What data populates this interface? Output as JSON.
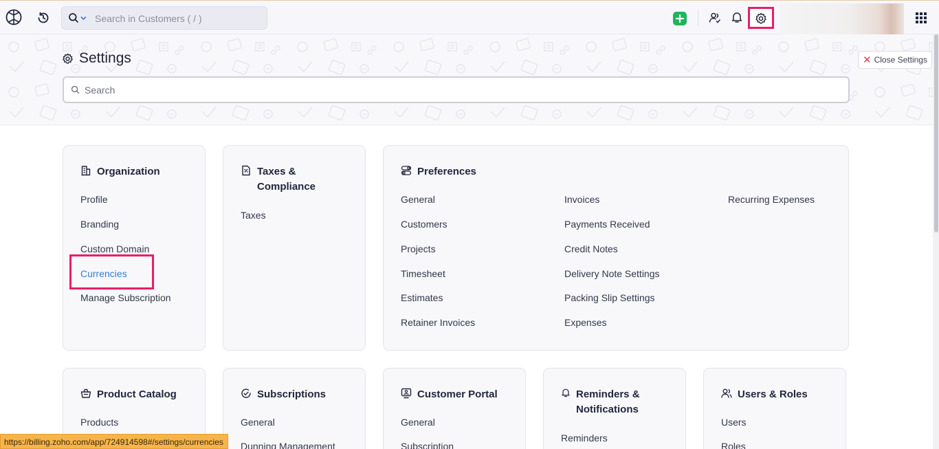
{
  "topbar": {
    "global_search_placeholder": "Search in Customers ( / )"
  },
  "header": {
    "title": "Settings",
    "close_label": "Close Settings",
    "search_placeholder": "Search"
  },
  "cards": {
    "organization": {
      "title": "Organization",
      "items": [
        "Profile",
        "Branding",
        "Custom Domain",
        "Currencies",
        "Manage Subscription"
      ]
    },
    "taxes": {
      "title_line1": "Taxes &",
      "title_line2": "Compliance",
      "items": [
        "Taxes"
      ]
    },
    "preferences": {
      "title": "Preferences",
      "col1": [
        "General",
        "Customers",
        "Projects",
        "Timesheet",
        "Estimates",
        "Retainer Invoices"
      ],
      "col2": [
        "Invoices",
        "Payments Received",
        "Credit Notes",
        "Delivery Note Settings",
        "Packing Slip Settings",
        "Expenses"
      ],
      "col3": [
        "Recurring Expenses"
      ]
    },
    "product_catalog": {
      "title": "Product Catalog",
      "items": [
        "Products"
      ]
    },
    "subscriptions": {
      "title": "Subscriptions",
      "items": [
        "General",
        "Dunning Management"
      ]
    },
    "customer_portal": {
      "title": "Customer Portal",
      "items": [
        "General",
        "Subscription"
      ]
    },
    "reminders": {
      "title_line1": "Reminders &",
      "title_line2": "Notifications",
      "items": [
        "Reminders"
      ]
    },
    "users_roles": {
      "title": "Users & Roles",
      "items": [
        "Users",
        "Roles"
      ]
    }
  },
  "status_bar": {
    "url": "https://billing.zoho.com/app/724914598#/settings/currencies"
  },
  "colors": {
    "accent": "#2f7fd3",
    "highlight": "#ea1e63",
    "quick_create": "#22b35e"
  },
  "icons": {
    "logo": "zoho-logo-icon",
    "recent": "recent-history-icon",
    "search": "search-icon",
    "quick_create": "plus-icon",
    "users": "users-icon",
    "bell": "bell-icon",
    "settings": "gear-icon",
    "apps": "app-grid-icon"
  }
}
